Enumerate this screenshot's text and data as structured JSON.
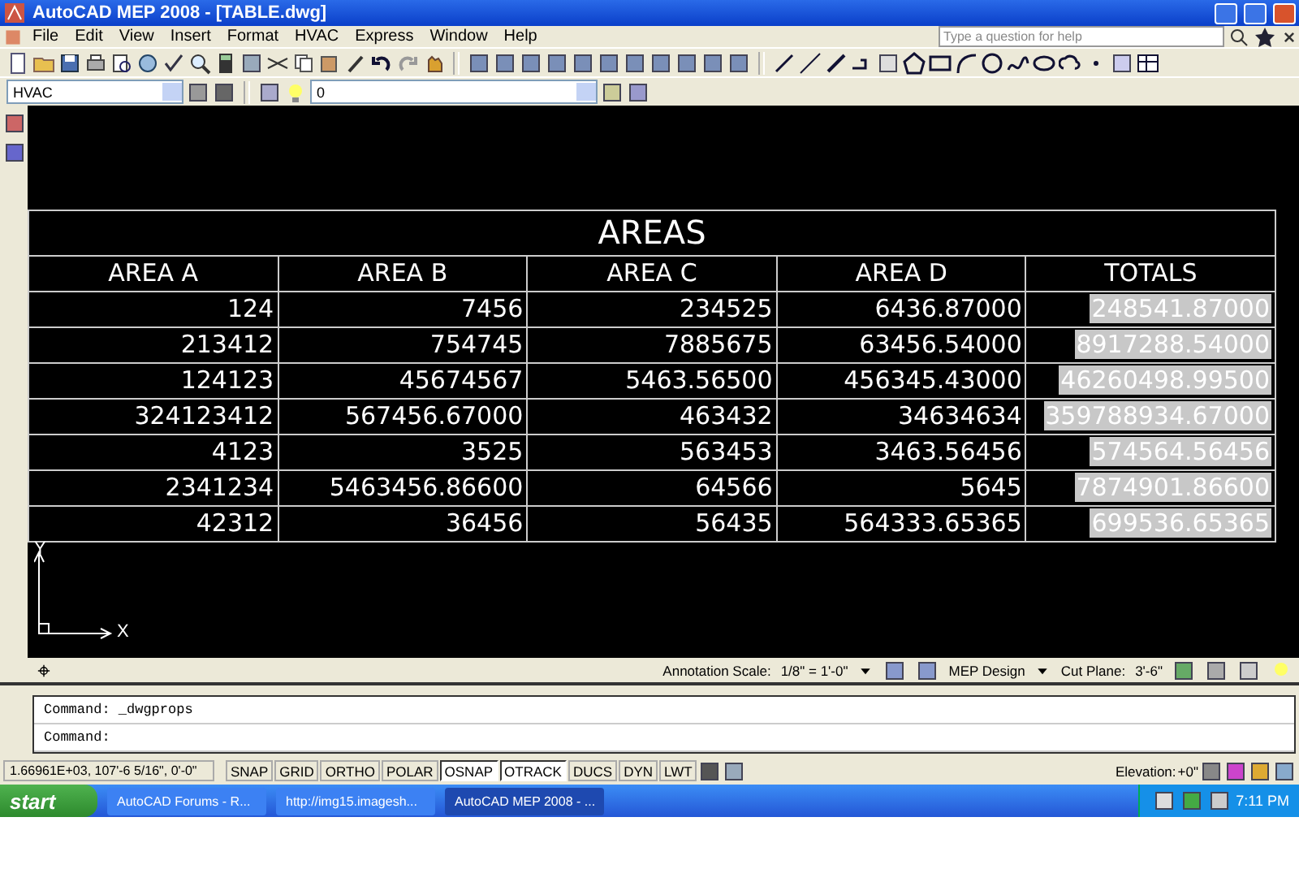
{
  "window": {
    "title": "AutoCAD MEP 2008 - [TABLE.dwg]"
  },
  "menu": [
    "File",
    "Edit",
    "View",
    "Insert",
    "Format",
    "HVAC",
    "Express",
    "Window",
    "Help"
  ],
  "help_search": {
    "placeholder": "Type a question for help"
  },
  "workspace_dropdown": {
    "value": "HVAC"
  },
  "layer_dropdown": {
    "value": "0"
  },
  "table": {
    "title": "AREAS",
    "columns": [
      {
        "label": "AREA A",
        "kind": "value"
      },
      {
        "label": "AREA B",
        "kind": "value"
      },
      {
        "label": "AREA C",
        "kind": "value"
      },
      {
        "label": "AREA D",
        "kind": "value"
      },
      {
        "label": "TOTALS",
        "kind": "field"
      }
    ],
    "rows": [
      [
        "124",
        "7456",
        "234525",
        "6436.87000",
        "248541.87000"
      ],
      [
        "213412",
        "754745",
        "7885675",
        "63456.54000",
        "8917288.54000"
      ],
      [
        "124123",
        "45674567",
        "5463.56500",
        "456345.43000",
        "46260498.99500"
      ],
      [
        "324123412",
        "567456.67000",
        "463432",
        "34634634",
        "359788934.67000"
      ],
      [
        "4123",
        "3525",
        "563453",
        "3463.56456",
        "574564.56456"
      ],
      [
        "2341234",
        "5463456.86600",
        "64566",
        "5645",
        "7874901.86600"
      ],
      [
        "42312",
        "36456",
        "56435",
        "564333.65365",
        "699536.65365"
      ]
    ]
  },
  "ucs": {
    "y_label": "Y",
    "x_label": "X"
  },
  "drawing_status": {
    "annotation_label": "Annotation Scale:",
    "annotation_value": "1/8\" = 1'-0\"",
    "display_config": "MEP Design",
    "cut_plane_label": "Cut Plane:",
    "cut_plane_value": "3'-6\""
  },
  "command_lines": [
    "Command:  _dwgprops",
    "Command:"
  ],
  "status_bar": {
    "coordinates": "1.66961E+03, 107'-6 5/16\", 0'-0\"",
    "toggles": [
      {
        "label": "SNAP",
        "on": false
      },
      {
        "label": "GRID",
        "on": false
      },
      {
        "label": "ORTHO",
        "on": false
      },
      {
        "label": "POLAR",
        "on": false
      },
      {
        "label": "OSNAP",
        "on": true
      },
      {
        "label": "OTRACK",
        "on": true
      },
      {
        "label": "DUCS",
        "on": false
      },
      {
        "label": "DYN",
        "on": false
      },
      {
        "label": "LWT",
        "on": false
      }
    ],
    "elevation_label": "Elevation:",
    "elevation_value": "+0\""
  },
  "taskbar": {
    "start": "start",
    "items": [
      {
        "label": "AutoCAD Forums - R...",
        "selected": false
      },
      {
        "label": "http://img15.imagesh...",
        "selected": false
      },
      {
        "label": "AutoCAD MEP 2008 - ...",
        "selected": true
      }
    ],
    "clock": "7:11 PM"
  }
}
